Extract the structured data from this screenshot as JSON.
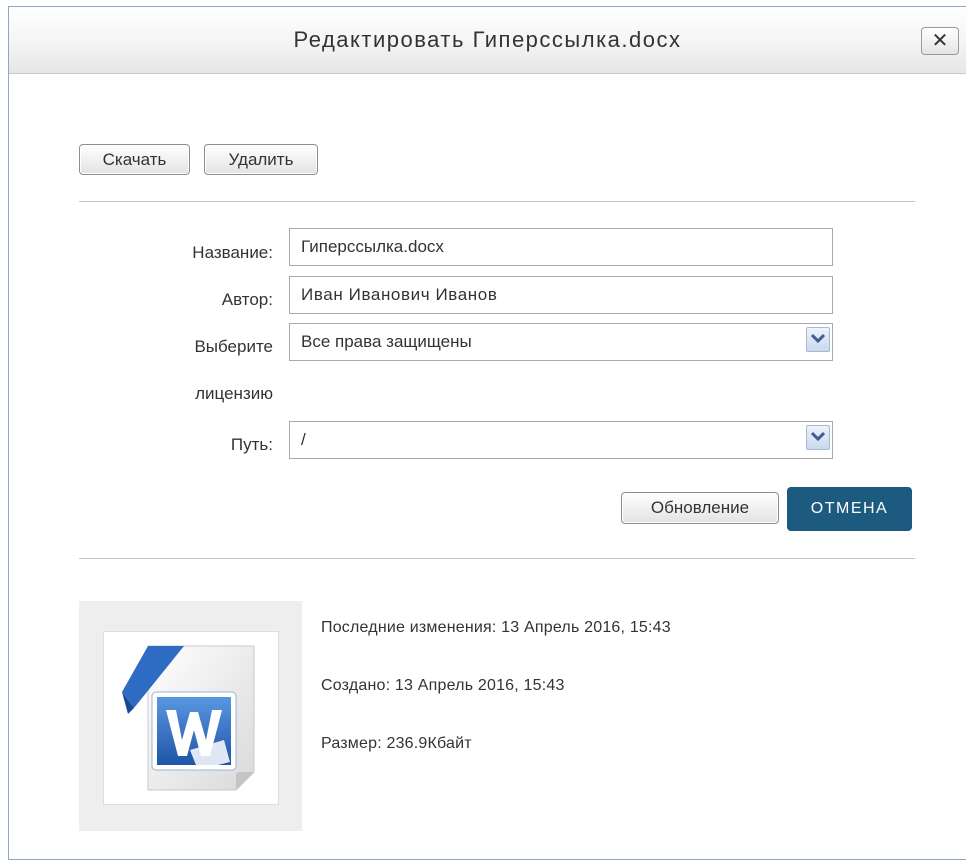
{
  "dialog": {
    "title": "Редактировать Гиперссылка.docx",
    "close_label": "✕"
  },
  "toolbar": {
    "download_label": "Скачать",
    "delete_label": "Удалить"
  },
  "form": {
    "name_label": "Название:",
    "name_value": "Гиперссылка.docx",
    "author_label": "Автор:",
    "author_value": "Иван Иванович Иванов",
    "license_label_line1": "Выберите",
    "license_label_line2": "лицензию",
    "license_value": "Все права защищены",
    "path_label": "Путь:",
    "path_value": "/",
    "update_label": "Обновление",
    "cancel_label": "ОТМЕНА"
  },
  "file_info": {
    "last_modified": "Последние изменения: 13 Апрель 2016, 15:43",
    "created": "Создано: 13 Апрель 2016, 15:43",
    "size": "Размер: 236.9Кбайт",
    "icon": "word-document-icon"
  },
  "colors": {
    "primary_button": "#1d5a80",
    "word_blue": "#2b6cc4"
  }
}
